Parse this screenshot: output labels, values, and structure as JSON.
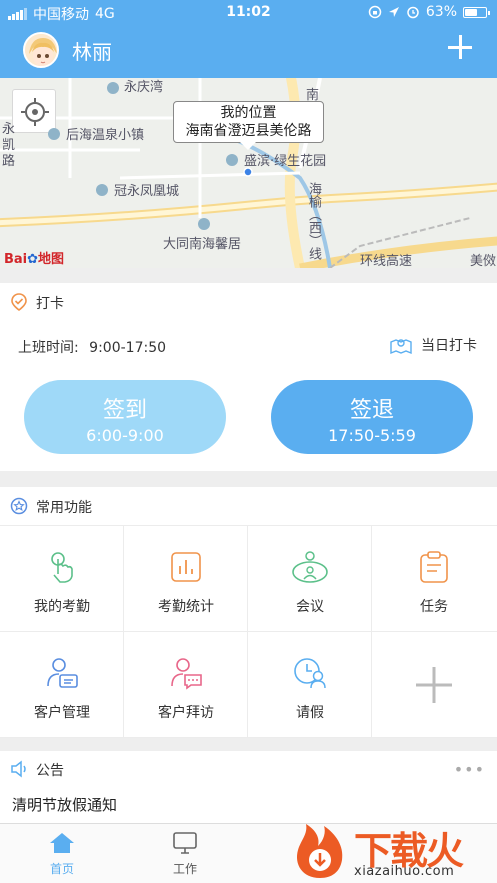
{
  "status_bar": {
    "carrier": "中国移动",
    "network": "4G",
    "time": "11:02",
    "battery": "63%",
    "battery_level": 0.63
  },
  "header": {
    "user_name": "林丽",
    "add_icon": "plus-icon",
    "bg_color": "#5aaef0"
  },
  "map": {
    "bubble_title": "我的位置",
    "bubble_address": "海南省澄迈县美伦路",
    "labels": {
      "yongqingwan": "永庆湾",
      "houhai": "后海温泉小镇",
      "yongkai": "永\n凯\n路",
      "guanyong": "冠永凤凰城",
      "datong": "大同南海馨居",
      "shengying": "盛滨·绿生花园",
      "nan": "南",
      "haiyu": "海榆（西）线",
      "huanxian": "环线高速",
      "meiyao": "美傚"
    },
    "logo_brand": "Bai",
    "logo_suffix": "地图"
  },
  "clock_in": {
    "title": "打卡",
    "work_time_label": "上班时间:",
    "work_time_value": "9:00-17:50",
    "today_punch": "当日打卡",
    "sign_in": {
      "label": "签到",
      "time": "6:00-9:00",
      "color": "#9fd9f8"
    },
    "sign_out": {
      "label": "签退",
      "time": "17:50-5:59",
      "color": "#5aaef0"
    }
  },
  "functions": {
    "title": "常用功能",
    "items": [
      {
        "label": "我的考勤",
        "icon": "hand-tap-icon",
        "color": "#5cc08a"
      },
      {
        "label": "考勤统计",
        "icon": "bar-chart-icon",
        "color": "#f0934a"
      },
      {
        "label": "会议",
        "icon": "meeting-icon",
        "color": "#5cc08a"
      },
      {
        "label": "任务",
        "icon": "clipboard-icon",
        "color": "#f0934a"
      },
      {
        "label": "客户管理",
        "icon": "customer-card-icon",
        "color": "#5a8ee0"
      },
      {
        "label": "客户拜访",
        "icon": "visit-chat-icon",
        "color": "#e8678a"
      },
      {
        "label": "请假",
        "icon": "leave-clock-icon",
        "color": "#5aaef0"
      },
      {
        "label": "",
        "icon": "add-icon",
        "color": "#bbbbbb"
      }
    ]
  },
  "notice": {
    "title": "公告",
    "items": [
      "清明节放假通知"
    ]
  },
  "tabbar": {
    "tabs": [
      {
        "label": "首页",
        "icon": "home-icon",
        "active": true
      },
      {
        "label": "工作",
        "icon": "monitor-icon",
        "active": false
      }
    ],
    "active_color": "#5aaef0"
  },
  "watermark": {
    "text": "下载火",
    "sub": "xiazaihuo.com"
  }
}
